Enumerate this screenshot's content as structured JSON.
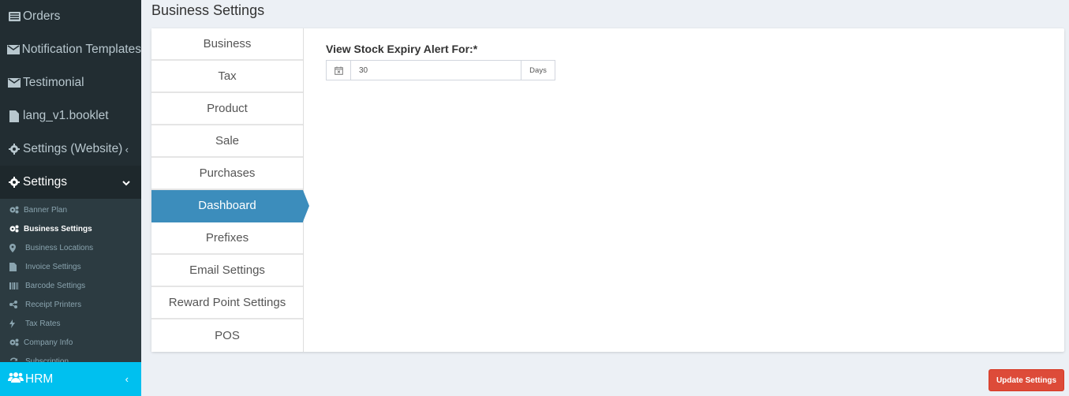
{
  "sidebar": {
    "items": [
      {
        "label": "Orders",
        "icon": "list-icon"
      },
      {
        "label": "Notification Templates",
        "icon": "envelope-icon"
      },
      {
        "label": "Testimonial",
        "icon": "envelope-icon"
      },
      {
        "label": "lang_v1.booklet",
        "icon": "file-icon"
      },
      {
        "label": "Settings (Website)",
        "icon": "gear-icon",
        "chevron": "‹"
      },
      {
        "label": "Settings",
        "icon": "gear-icon",
        "chevron": "⌄"
      }
    ],
    "submenu": [
      {
        "label": "Banner Plan",
        "icon": "cogs-icon"
      },
      {
        "label": "Business Settings",
        "icon": "cogs-icon",
        "active": true
      },
      {
        "label": "Business Locations",
        "icon": "map-marker-icon"
      },
      {
        "label": "Invoice Settings",
        "icon": "file-icon"
      },
      {
        "label": "Barcode Settings",
        "icon": "barcode-icon"
      },
      {
        "label": "Receipt Printers",
        "icon": "share-icon"
      },
      {
        "label": "Tax Rates",
        "icon": "bolt-icon"
      },
      {
        "label": "Company Info",
        "icon": "cogs-icon"
      },
      {
        "label": "Subscription",
        "icon": "refresh-icon"
      }
    ],
    "hrm": {
      "label": "HRM",
      "icon": "users-icon",
      "chevron": "‹"
    }
  },
  "header": {
    "title": "Business Settings"
  },
  "tabs": [
    {
      "label": "Business"
    },
    {
      "label": "Tax"
    },
    {
      "label": "Product"
    },
    {
      "label": "Sale"
    },
    {
      "label": "Purchases"
    },
    {
      "label": "Dashboard",
      "active": true
    },
    {
      "label": "Prefixes"
    },
    {
      "label": "Email Settings"
    },
    {
      "label": "Reward Point Settings"
    },
    {
      "label": "POS"
    }
  ],
  "dashboard": {
    "stock_expiry_label": "View Stock Expiry Alert For:*",
    "stock_expiry_value": "30",
    "stock_expiry_unit": "Days"
  },
  "actions": {
    "update_label": "Update Settings"
  },
  "colors": {
    "sidebar_bg": "#222d32",
    "active_tab": "#3c8dbc",
    "hrm_bg": "#00c0ef",
    "update_btn": "#dd4b39"
  }
}
